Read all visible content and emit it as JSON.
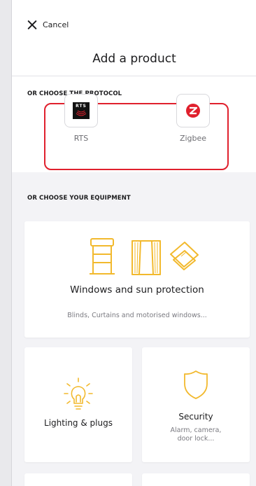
{
  "header": {
    "cancel_label": "Cancel",
    "title": "Add a product"
  },
  "protocol_section": {
    "label": "OR CHOOSE THE PROTOCOL",
    "items": [
      {
        "name": "RTS",
        "logo_text": "RTS",
        "icon": "rts-logo-icon"
      },
      {
        "name": "Zigbee",
        "icon": "zigbee-logo-icon"
      }
    ],
    "highlight_color": "#e0202d"
  },
  "equipment_section": {
    "label": "OR CHOOSE YOUR EQUIPMENT",
    "cards": [
      {
        "title": "Windows and sun protection",
        "subtitle": "Blinds, Curtains and motorised windows...",
        "icons": [
          "blind-icon",
          "curtain-icon",
          "roof-window-icon"
        ]
      },
      {
        "title": "Lighting & plugs",
        "subtitle": "",
        "icon": "light-bulb-icon"
      },
      {
        "title": "Security",
        "subtitle": "Alarm, camera, door lock...",
        "icon": "shield-icon"
      }
    ],
    "accent_color": "#f2b92d"
  }
}
